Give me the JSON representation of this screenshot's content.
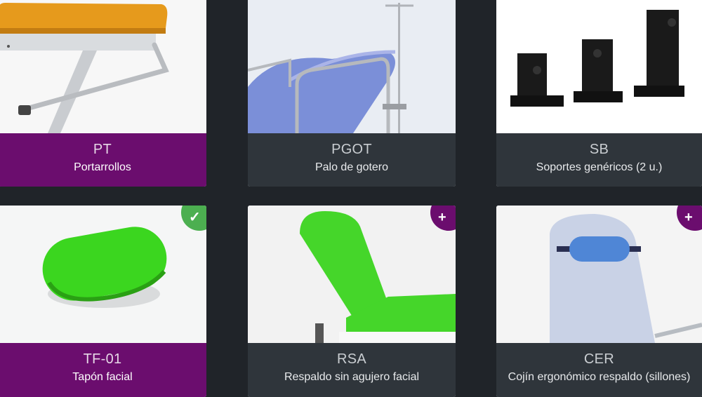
{
  "colors": {
    "background": "#202429",
    "caption": "#2f353b",
    "selected": "#6b0d6e",
    "check": "#4caf50"
  },
  "products": [
    {
      "code": "PT",
      "name": "Portarrollos",
      "selected": true,
      "badge_icon": "check-icon"
    },
    {
      "code": "PGOT",
      "name": "Palo de gotero",
      "selected": false,
      "badge_icon": "plus-icon"
    },
    {
      "code": "SB",
      "name": "Soportes genéricos (2 u.)",
      "selected": false,
      "badge_icon": "plus-icon"
    },
    {
      "code": "TF-01",
      "name": "Tapón facial",
      "selected": true,
      "badge_icon": "check-icon"
    },
    {
      "code": "RSA",
      "name": "Respaldo sin agujero facial",
      "selected": false,
      "badge_icon": "plus-icon"
    },
    {
      "code": "CER",
      "name": "Cojín ergonómico respaldo (sillones)",
      "selected": false,
      "badge_icon": "plus-icon"
    }
  ],
  "badges": {
    "check": "✓",
    "plus": "+"
  }
}
